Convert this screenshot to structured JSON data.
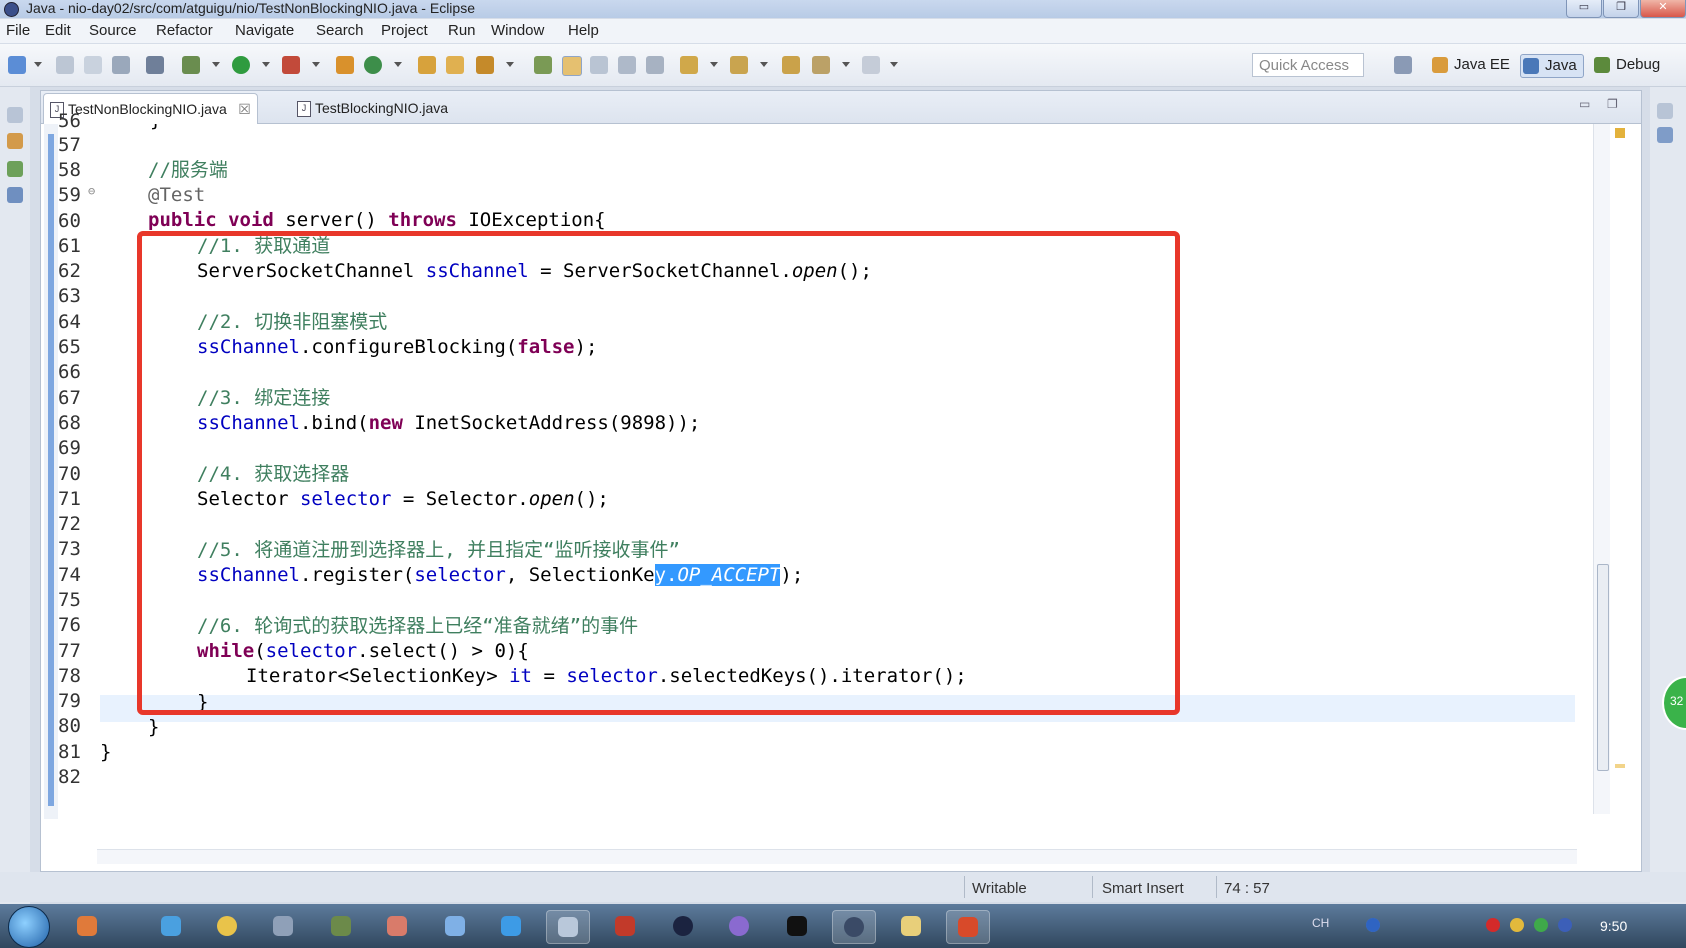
{
  "window": {
    "title": "Java - nio-day02/src/com/atguigu/nio/TestNonBlockingNIO.java - Eclipse",
    "controls": {
      "minimize": "▭",
      "maximize": "❐",
      "close": "✕"
    }
  },
  "menu": [
    "File",
    "Edit",
    "Source",
    "Refactor",
    "Navigate",
    "Search",
    "Project",
    "Run",
    "Window",
    "Help"
  ],
  "toolbar": {
    "quick_access_placeholder": "Quick Access",
    "perspectives": [
      "Java EE",
      "Java",
      "Debug"
    ]
  },
  "editor": {
    "tabs": [
      {
        "label": "TestNonBlockingNIO.java",
        "active": true,
        "close": "☒"
      },
      {
        "label": "TestBlockingNIO.java",
        "active": false
      }
    ],
    "line_numbers": [
      "56",
      "57",
      "58",
      "59",
      "60",
      "61",
      "62",
      "63",
      "64",
      "65",
      "66",
      "67",
      "68",
      "69",
      "70",
      "71",
      "72",
      "73",
      "74",
      "75",
      "76",
      "77",
      "78",
      "79",
      "80",
      "81",
      "82"
    ],
    "folding_marker": "⊖",
    "code": {
      "l56": "}",
      "l58": "//服务端",
      "l59": "@Test",
      "l60_kw1": "public",
      "l60_kw2": "void",
      "l60_a": " server() ",
      "l60_kw3": "throws",
      "l60_b": " IOException{",
      "l61": "//1. 获取通道",
      "l62_a": "ServerSocketChannel ",
      "l62_var": "ssChannel",
      "l62_b": " = ServerSocketChannel.",
      "l62_m": "open",
      "l62_c": "();",
      "l64": "//2. 切换非阻塞模式",
      "l65_var": "ssChannel",
      "l65_a": ".configureBlocking(",
      "l65_kw": "false",
      "l65_b": ");",
      "l67": "//3. 绑定连接",
      "l68_var": "ssChannel",
      "l68_a": ".bind(",
      "l68_kw": "new",
      "l68_b": " InetSocketAddress(9898));",
      "l70": "//4. 获取选择器",
      "l71_a": "Selector ",
      "l71_var": "selector",
      "l71_b": " = Selector.",
      "l71_m": "open",
      "l71_c": "();",
      "l73": "//5. 将通道注册到选择器上, 并且指定“监听接收事件”",
      "l74_var": "ssChannel",
      "l74_a": ".register(",
      "l74_var2": "selector",
      "l74_b": ", SelectionKe",
      "l74_sel1": "y.",
      "l74_sel2": "OP_ACCEPT",
      "l74_c": ");",
      "l76": "//6. 轮询式的获取选择器上已经“准备就绪”的事件",
      "l77_kw": "while",
      "l77_a": "(",
      "l77_var": "selector",
      "l77_b": ".select() > 0){",
      "l78_a": "Iterator<SelectionKey> ",
      "l78_var": "it",
      "l78_b": " = ",
      "l78_var2": "selector",
      "l78_c": ".selectedKeys().iterator();",
      "l79": "}",
      "l80": "}",
      "l81": "}"
    }
  },
  "status": {
    "writable": "Writable",
    "insert_mode": "Smart Insert",
    "position": "74 : 57"
  },
  "taskbar": {
    "language": "CH",
    "clock": "9:50",
    "badge": "32"
  },
  "colors": {
    "highlight_box": "#e8372a",
    "selection": "#3399ff",
    "keyword": "#7f0055",
    "comment": "#3f7f5f",
    "field": "#0000c0"
  }
}
